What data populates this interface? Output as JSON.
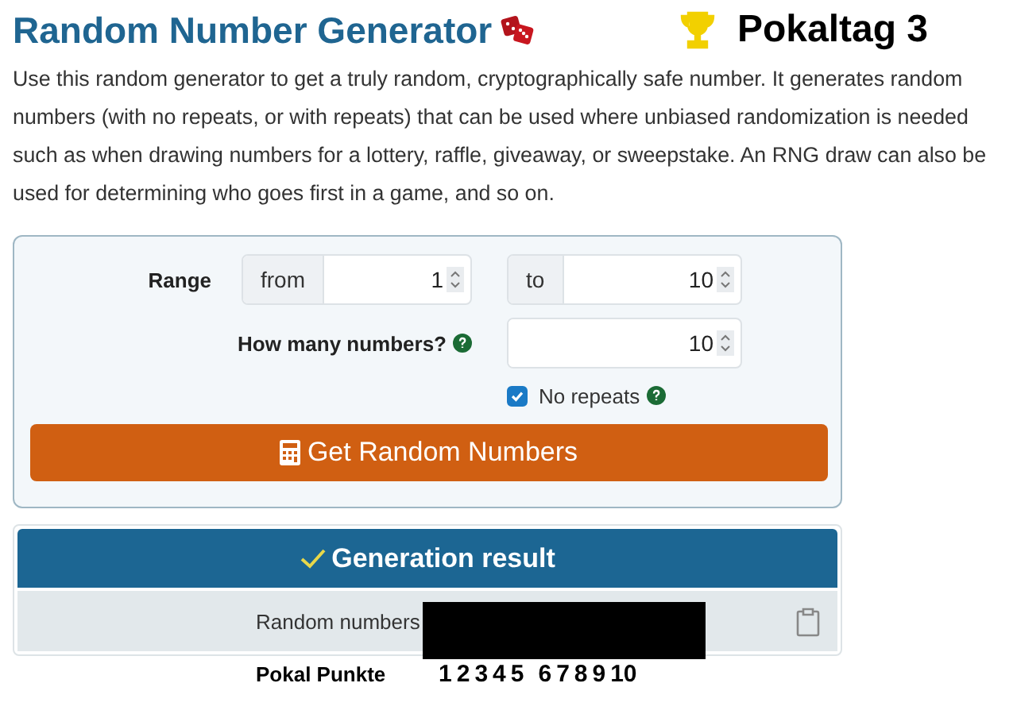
{
  "title": "Random Number Generator",
  "badge": "Pokaltag 3",
  "description": "Use this random generator to get a truly random, cryptographically safe number. It generates random numbers (with no repeats, or with repeats) that can be used where unbiased randomization is needed such as when drawing numbers for a lottery, raffle, giveaway, or sweepstake. An RNG draw can also be used for determining who goes first in a game, and so on.",
  "form": {
    "range_label": "Range",
    "from_label": "from",
    "from_value": "1",
    "to_label": "to",
    "to_value": "10",
    "count_label": "How many numbers?",
    "count_value": "10",
    "no_repeats": {
      "label": "No repeats",
      "checked": true
    },
    "button": "Get Random Numbers"
  },
  "result": {
    "title": "Generation result",
    "row_label": "Random numbers"
  },
  "points": {
    "label": "Pokal Punkte",
    "numbers": [
      "1",
      "2",
      "3",
      "4",
      "5",
      "6",
      "7",
      "8",
      "9",
      "10"
    ]
  }
}
